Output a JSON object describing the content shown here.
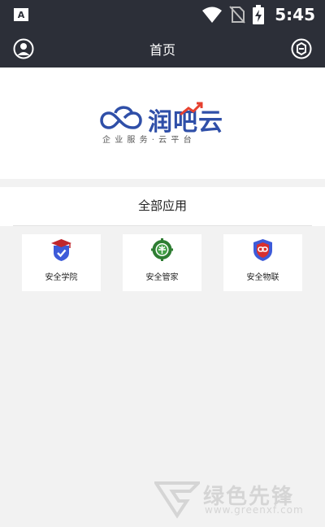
{
  "status_bar": {
    "time": "5:45",
    "icons": [
      "app-notification-icon",
      "wifi-icon",
      "no-sim-icon",
      "battery-charging-icon"
    ]
  },
  "app_bar": {
    "title": "首页",
    "left_icon": "user-avatar-icon",
    "right_icon": "scan-icon"
  },
  "banner": {
    "logo_text": "润吧云",
    "slogan": "企业服务·云平台",
    "brand_color": "#2f4fa8",
    "accent_color": "#e6402f"
  },
  "apps_section": {
    "header": "全部应用",
    "items": [
      {
        "label": "安全学院",
        "icon": "graduation-shield-icon"
      },
      {
        "label": "安全管家",
        "icon": "gear-globe-icon"
      },
      {
        "label": "安全物联",
        "icon": "link-shield-icon"
      }
    ]
  },
  "watermark": {
    "text": "绿色先锋",
    "url": "www.greenxf.com"
  }
}
